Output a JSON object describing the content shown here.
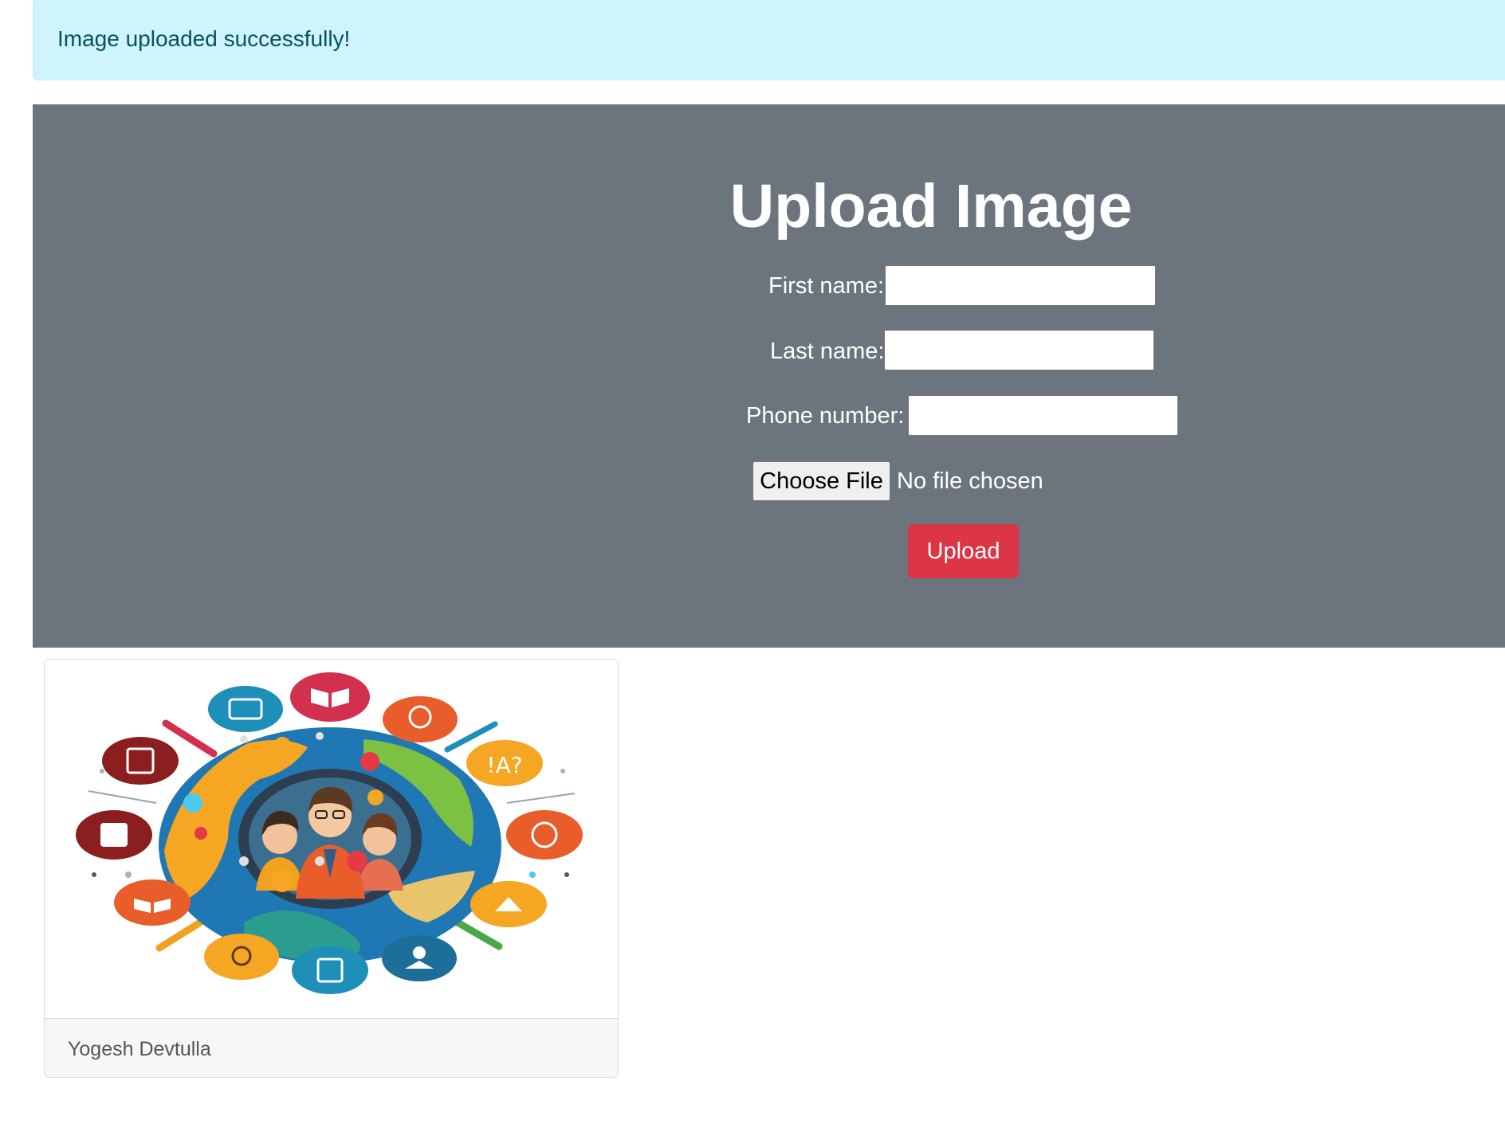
{
  "alert": {
    "message": "Image uploaded successfully!"
  },
  "form": {
    "title": "Upload Image",
    "first_name_label": "First name:",
    "first_name_value": "",
    "last_name_label": "Last name:",
    "last_name_value": "",
    "phone_label": "Phone number:",
    "phone_value": "",
    "choose_file_label": "Choose File",
    "file_status": "No file chosen",
    "upload_label": "Upload"
  },
  "gallery": {
    "items": [
      {
        "caption": "Yogesh Devtulla",
        "image": "education-globe-illustration"
      }
    ]
  },
  "colors": {
    "alert_bg": "#cff4fc",
    "alert_text": "#055160",
    "hero_bg": "#6c757d",
    "upload_button": "#dc3545"
  }
}
